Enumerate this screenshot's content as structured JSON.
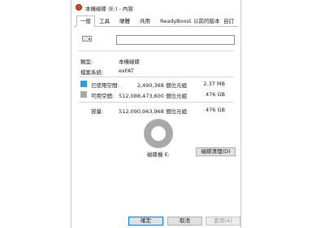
{
  "window": {
    "title": "本機磁碟 (E:) - 內容"
  },
  "tabs": [
    {
      "label": "一般"
    },
    {
      "label": "工具"
    },
    {
      "label": "硬體"
    },
    {
      "label": "共用"
    },
    {
      "label": "ReadyBoost"
    },
    {
      "label": "以前的版本"
    },
    {
      "label": "自訂"
    }
  ],
  "general": {
    "name_value": "",
    "type_label": "類型:",
    "type_value": "本機磁碟",
    "fs_label": "檔案系統:",
    "fs_value": "exFAT",
    "used": {
      "label": "已使用空間:",
      "bytes": "2,490,368 個位元組",
      "size": "2.37 MB",
      "color": "#2b9de0"
    },
    "free": {
      "label": "可用空間:",
      "bytes": "512,088,473,600 個位元組",
      "size": "476 GB",
      "color": "#a9a9a9"
    },
    "capacity": {
      "label": "容量:",
      "bytes": "512,090,963,968 個位元組",
      "size": "476 GB"
    },
    "used_fraction": 4.9e-06,
    "drive_label": "磁碟機 E:",
    "cleanup_button": "磁碟清理(D)"
  },
  "footer": {
    "ok": "確定",
    "cancel": "取消",
    "apply": "套用(A)"
  }
}
